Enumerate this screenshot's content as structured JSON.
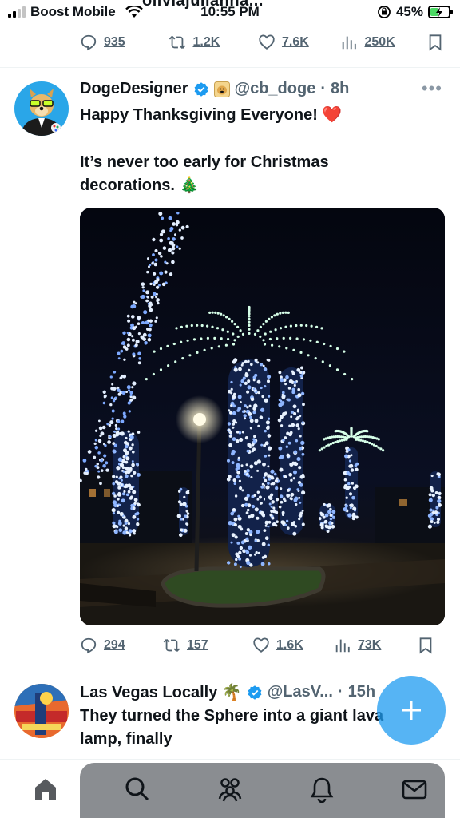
{
  "status_bar": {
    "carrier": "Boost Mobile",
    "time": "10:55 PM",
    "battery": "45%",
    "battery_level": 0.45,
    "partial_name": "oliviajulianna..."
  },
  "previous_tweet": {
    "replies": "935",
    "reposts": "1.2K",
    "likes": "7.6K",
    "views": "250K"
  },
  "tweet": {
    "name": "DogeDesigner",
    "handle": "@cb_doge",
    "time": "8h",
    "line1": "Happy Thanksgiving Everyone! ❤️",
    "line2": "It’s never too early for Christmas\ndecorations. 🎄",
    "replies": "294",
    "reposts": "157",
    "likes": "1.6K",
    "views": "73K"
  },
  "next_tweet": {
    "name": "Las Vegas Locally 🌴",
    "handle": "@LasV...",
    "time": "15h",
    "text": "They turned the Sphere into a giant lava\nlamp, finally"
  },
  "colors": {
    "accent": "#1d9bf0",
    "muted": "#536471",
    "verified": "#1d9bf0"
  },
  "icons": [
    "reply-icon",
    "repost-icon",
    "like-icon",
    "views-icon",
    "bookmark-icon",
    "verified-icon",
    "home-icon",
    "search-icon",
    "communities-icon",
    "notifications-icon",
    "messages-icon",
    "compose-plus-icon"
  ]
}
